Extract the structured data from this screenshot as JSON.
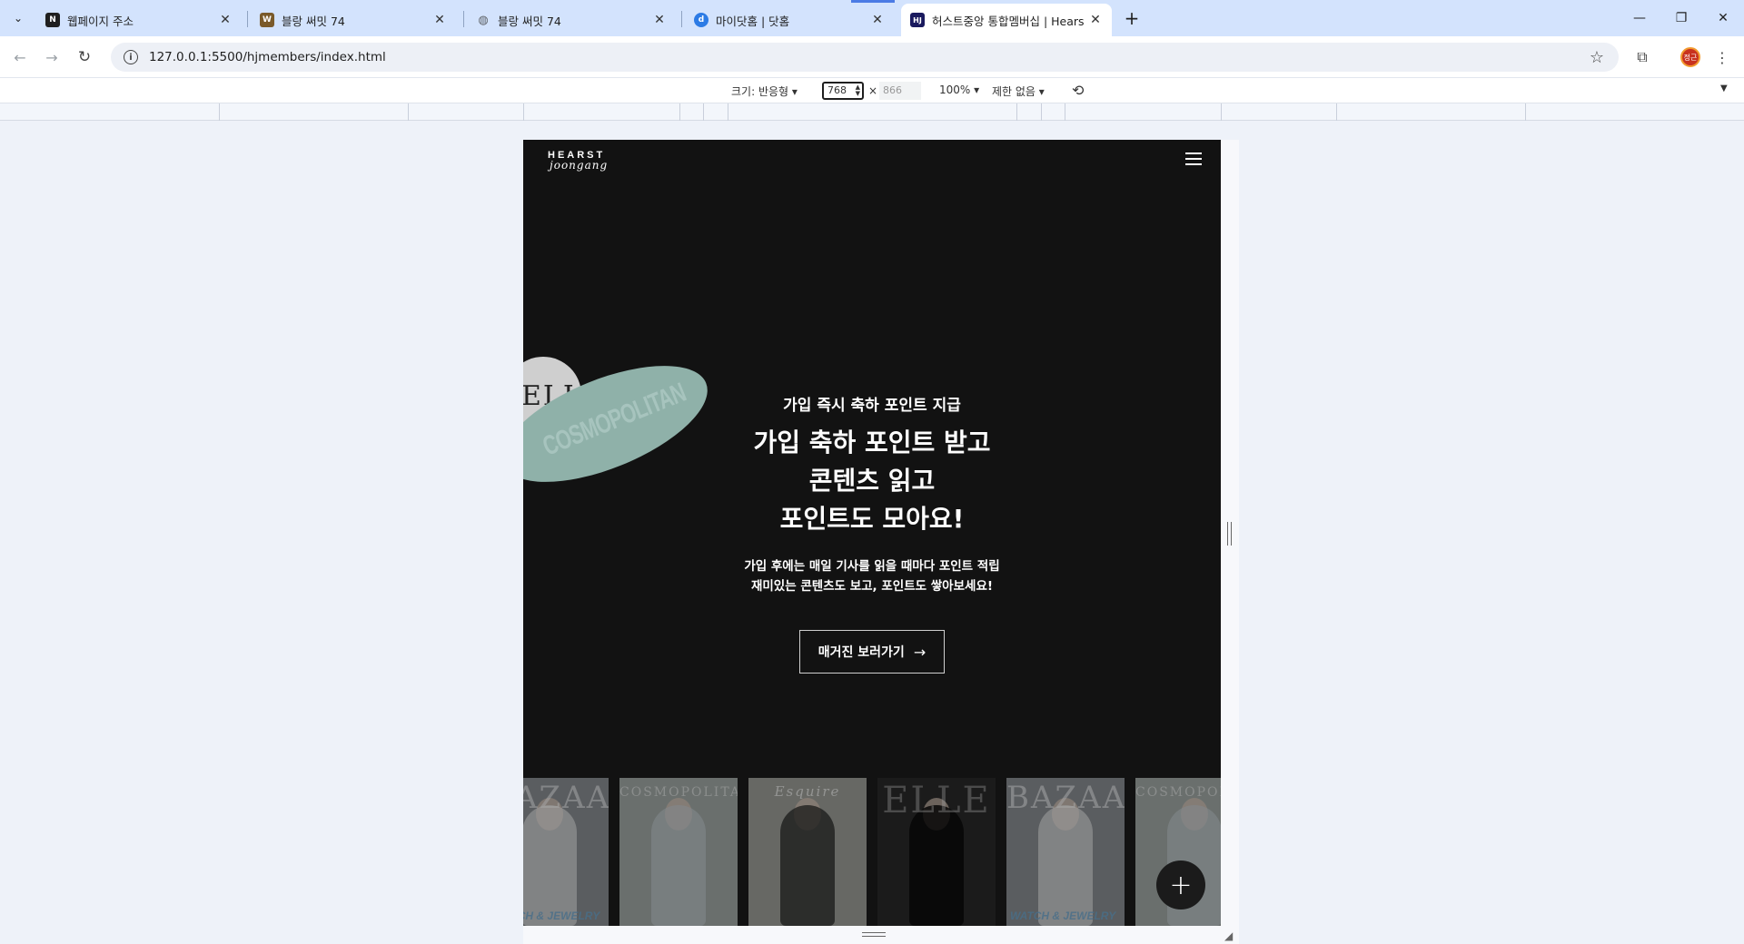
{
  "browser": {
    "tabs": [
      {
        "title": "웹페이지 주소",
        "favicon": "N",
        "favicon_color": "#1f1f1f"
      },
      {
        "title": "블랑 써밋 74",
        "favicon": "W",
        "favicon_color": "#7a5a2a"
      },
      {
        "title": "블랑 써밋 74",
        "favicon": "globe",
        "favicon_color": "#5f6368"
      },
      {
        "title": "마이닷홈 | 닷홈",
        "favicon": "d",
        "favicon_color": "#2c7be5"
      },
      {
        "title": "허스트중앙 통합멤버십 | Hears",
        "favicon": "HJ",
        "favicon_color": "#1a1a5e",
        "active": true
      }
    ],
    "new_tab_label": "+",
    "url": "127.0.0.1:5500/hjmembers/index.html",
    "profile_label": "정근"
  },
  "devtools": {
    "size_label": "크기: 반응형 ▾",
    "width": "768",
    "times": "×",
    "height": "866",
    "zoom": "100% ▾",
    "throttle": "제한 없음 ▾"
  },
  "site": {
    "logo_top": "HEARST",
    "logo_bottom": "joongang",
    "badges": {
      "elle": "ELLE",
      "cosmo": "COSMOPOLITAN"
    },
    "hero": {
      "subtitle": "가입 즉시 축하 포인트 지급",
      "headline_lines": [
        "가입 축하 포인트 받고",
        "콘텐츠 읽고",
        "포인트도 모아요!"
      ],
      "desc_lines": [
        "가입 후에는 매일 기사를 읽을 때마다 포인트 적립",
        "재미있는 콘텐츠도 보고, 포인트도 쌓아보세요!"
      ],
      "cta_label": "매거진 보러가기",
      "cta_arrow": "→"
    },
    "covers": [
      {
        "mast": "BAZAAR",
        "bottom": "WATCH & JEWELRY",
        "bg": "#8b8f94"
      },
      {
        "mast": "COSMOPOLITAN",
        "bottom": "",
        "bg": "#a3aba8"
      },
      {
        "mast": "Esquire",
        "bottom": "",
        "bg": "#9ea09a"
      },
      {
        "mast": "ELLE",
        "bottom": "",
        "bg": "#2a2a2a"
      },
      {
        "mast": "BAZAAR",
        "bottom": "WATCH & JEWELRY",
        "bg": "#8b8f94"
      },
      {
        "mast": "COSMOPOLITAN",
        "bottom": "",
        "bg": "#a3aba8"
      }
    ],
    "fab_label": "+"
  }
}
